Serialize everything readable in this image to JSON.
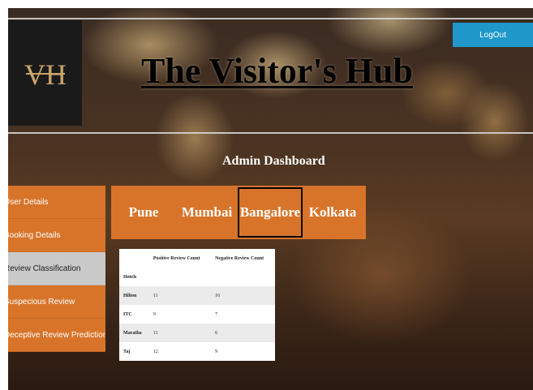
{
  "colors": {
    "accent": "#d8742a",
    "logout_bg": "#1f97c9",
    "active_item": "#c9c9c9"
  },
  "logo": {
    "text": "VH"
  },
  "header": {
    "title": "The Visitor's Hub",
    "logout_label": "LogOut"
  },
  "dashboard": {
    "title": "Admin Dashboard"
  },
  "sidebar": {
    "items": [
      {
        "label": "User Details"
      },
      {
        "label": "Booking Details"
      },
      {
        "label": "Review Classification",
        "active": true
      },
      {
        "label": "Suspecious Review"
      },
      {
        "label": "Deceptive Review Prediction"
      }
    ]
  },
  "cities": {
    "tabs": [
      {
        "label": "Pune"
      },
      {
        "label": "Mumbai"
      },
      {
        "label": "Bangalore",
        "active": true
      },
      {
        "label": "Kolkata"
      }
    ]
  },
  "table": {
    "headers": [
      "",
      "Positive Review Count",
      "Negative Review Count"
    ],
    "group_label": "Hotels",
    "rows": [
      {
        "hotel": "Hilton",
        "positive": "11",
        "negative": "16"
      },
      {
        "hotel": "ITC",
        "positive": "9",
        "negative": "7"
      },
      {
        "hotel": "Maratha",
        "positive": "11",
        "negative": "6"
      },
      {
        "hotel": "Taj",
        "positive": "12",
        "negative": "9"
      }
    ]
  }
}
